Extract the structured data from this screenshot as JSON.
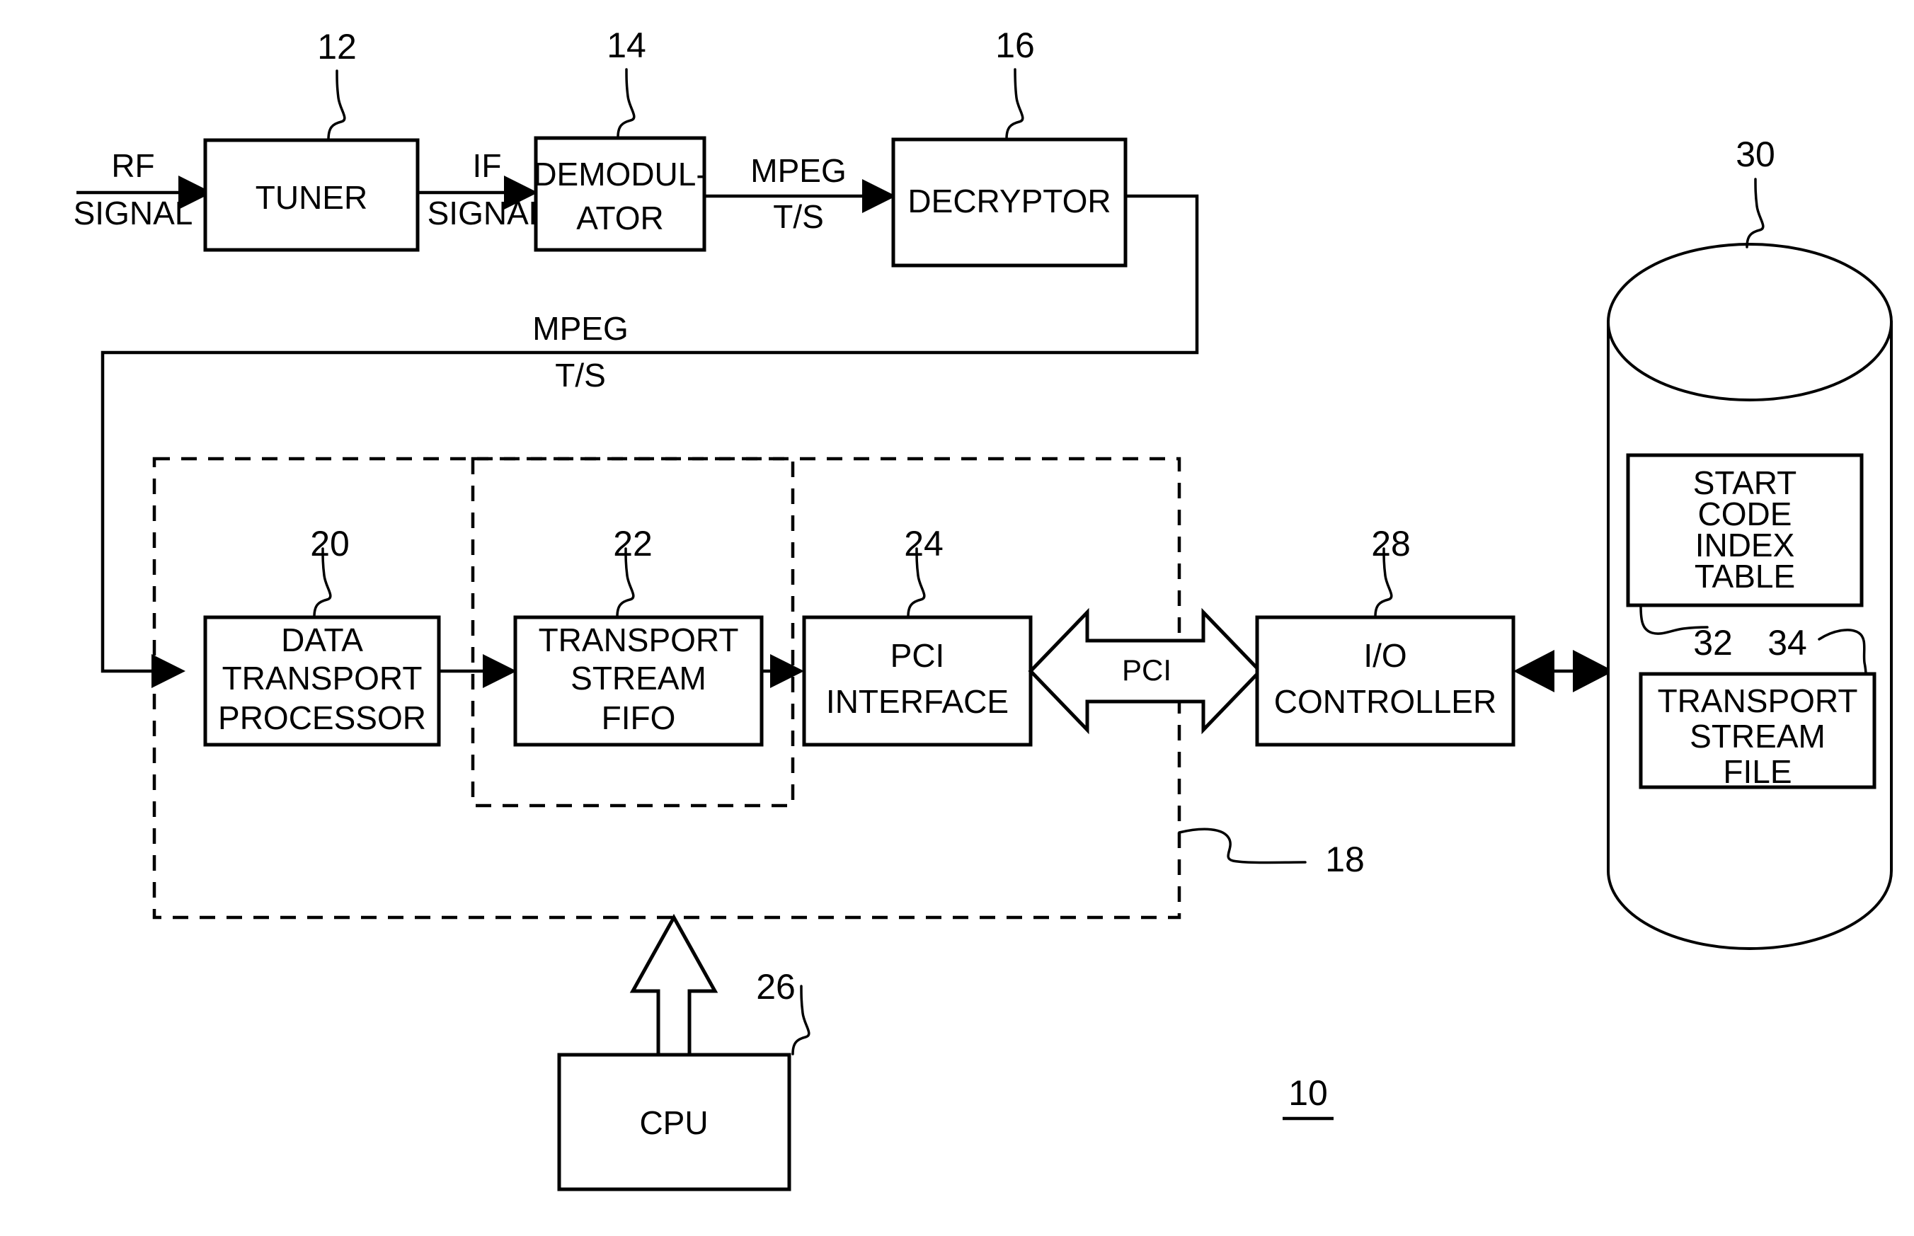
{
  "figure": {
    "figure_number": "10",
    "title": ""
  },
  "blocks": {
    "tuner": {
      "label": "TUNER",
      "ref": "12"
    },
    "demodulator": {
      "line1": "DEMODUL-",
      "line2": "ATOR",
      "ref": "14"
    },
    "decryptor": {
      "label": "DECRYPTOR",
      "ref": "16"
    },
    "data_transport_processor": {
      "line1": "DATA",
      "line2": "TRANSPORT",
      "line3": "PROCESSOR",
      "ref": "20"
    },
    "transport_stream_fifo": {
      "line1": "TRANSPORT",
      "line2": "STREAM",
      "line3": "FIFO",
      "ref": "22"
    },
    "pci_interface": {
      "line1": "PCI",
      "line2": "INTERFACE",
      "ref": "24"
    },
    "io_controller": {
      "line1": "I/O",
      "line2": "CONTROLLER",
      "ref": "28"
    },
    "cpu": {
      "label": "CPU",
      "ref": "26"
    },
    "storage": {
      "ref": "30"
    },
    "start_code_index_table": {
      "line1": "START",
      "line2": "CODE",
      "line3": "INDEX",
      "line4": "TABLE",
      "ref": "32"
    },
    "transport_stream_file": {
      "line1": "TRANSPORT",
      "line2": "STREAM",
      "line3": "FILE",
      "ref": "34"
    },
    "decoder_subsystem": {
      "ref": "18"
    }
  },
  "signals": {
    "rf_signal": {
      "line1": "RF",
      "line2": "SIGNAL"
    },
    "if_signal": {
      "line1": "IF",
      "line2": "SIGNAL"
    },
    "mpeg_ts_decryptor_in": {
      "line1": "MPEG",
      "line2": "T/S"
    },
    "mpeg_ts_feedback": {
      "line1": "MPEG",
      "line2": "T/S"
    },
    "pci_bus": {
      "label": "PCI"
    }
  }
}
